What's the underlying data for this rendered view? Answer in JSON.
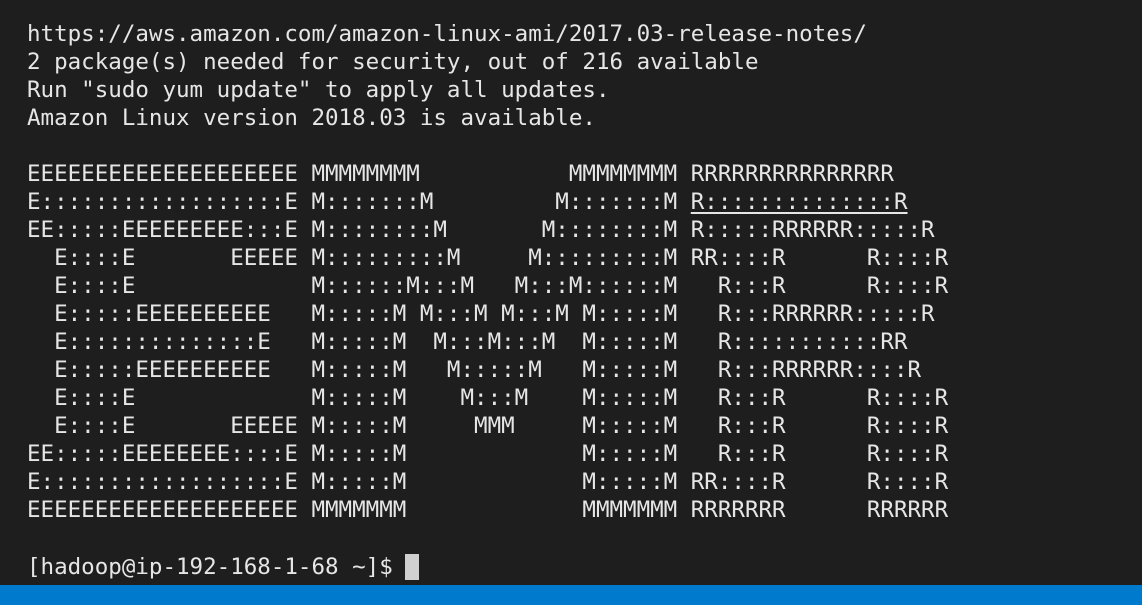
{
  "terminal": {
    "motd": [
      "https://aws.amazon.com/amazon-linux-ami/2017.03-release-notes/",
      "2 package(s) needed for security, out of 216 available",
      "Run \"sudo yum update\" to apply all updates.",
      "Amazon Linux version 2018.03 is available."
    ],
    "banner": [
      "EEEEEEEEEEEEEEEEEEEE MMMMMMMM           MMMMMMMM RRRRRRRRRRRRRRR",
      "E::::::::::::::::::E M:::::::M         M:::::::M ",
      "EE:::::EEEEEEEEE:::E M::::::::M       M::::::::M R:::::RRRRRR:::::R",
      "  E::::E       EEEEE M:::::::::M     M:::::::::M RR::::R      R::::R",
      "  E::::E             M::::::M:::M   M:::M::::::M   R:::R      R::::R",
      "  E:::::EEEEEEEEEE   M:::::M M:::M M:::M M:::::M   R:::RRRRRR:::::R",
      "  E::::::::::::::E   M:::::M  M:::M:::M  M:::::M   R:::::::::::RR",
      "  E:::::EEEEEEEEEE   M:::::M   M:::::M   M:::::M   R:::RRRRRR::::R",
      "  E::::E             M:::::M    M:::M    M:::::M   R:::R      R::::R",
      "  E::::E       EEEEE M:::::M     MMM     M:::::M   R:::R      R::::R",
      "EE:::::EEEEEEEE::::E M:::::M             M:::::M   R:::R      R::::R",
      "E::::::::::::::::::E M:::::M             M:::::M RR::::R      R::::R",
      "EEEEEEEEEEEEEEEEEEEE MMMMMMM             MMMMMMM RRRRRRR      RRRRRR"
    ],
    "banner_underlined_segment": "R::::::::::::::R",
    "prompt": "[hadoop@ip-192-168-1-68 ~]$"
  },
  "colors": {
    "background": "#1e1e1e",
    "text": "#e6e6e6",
    "cursor": "#d0d0d0",
    "status_bar": "#007acc"
  }
}
